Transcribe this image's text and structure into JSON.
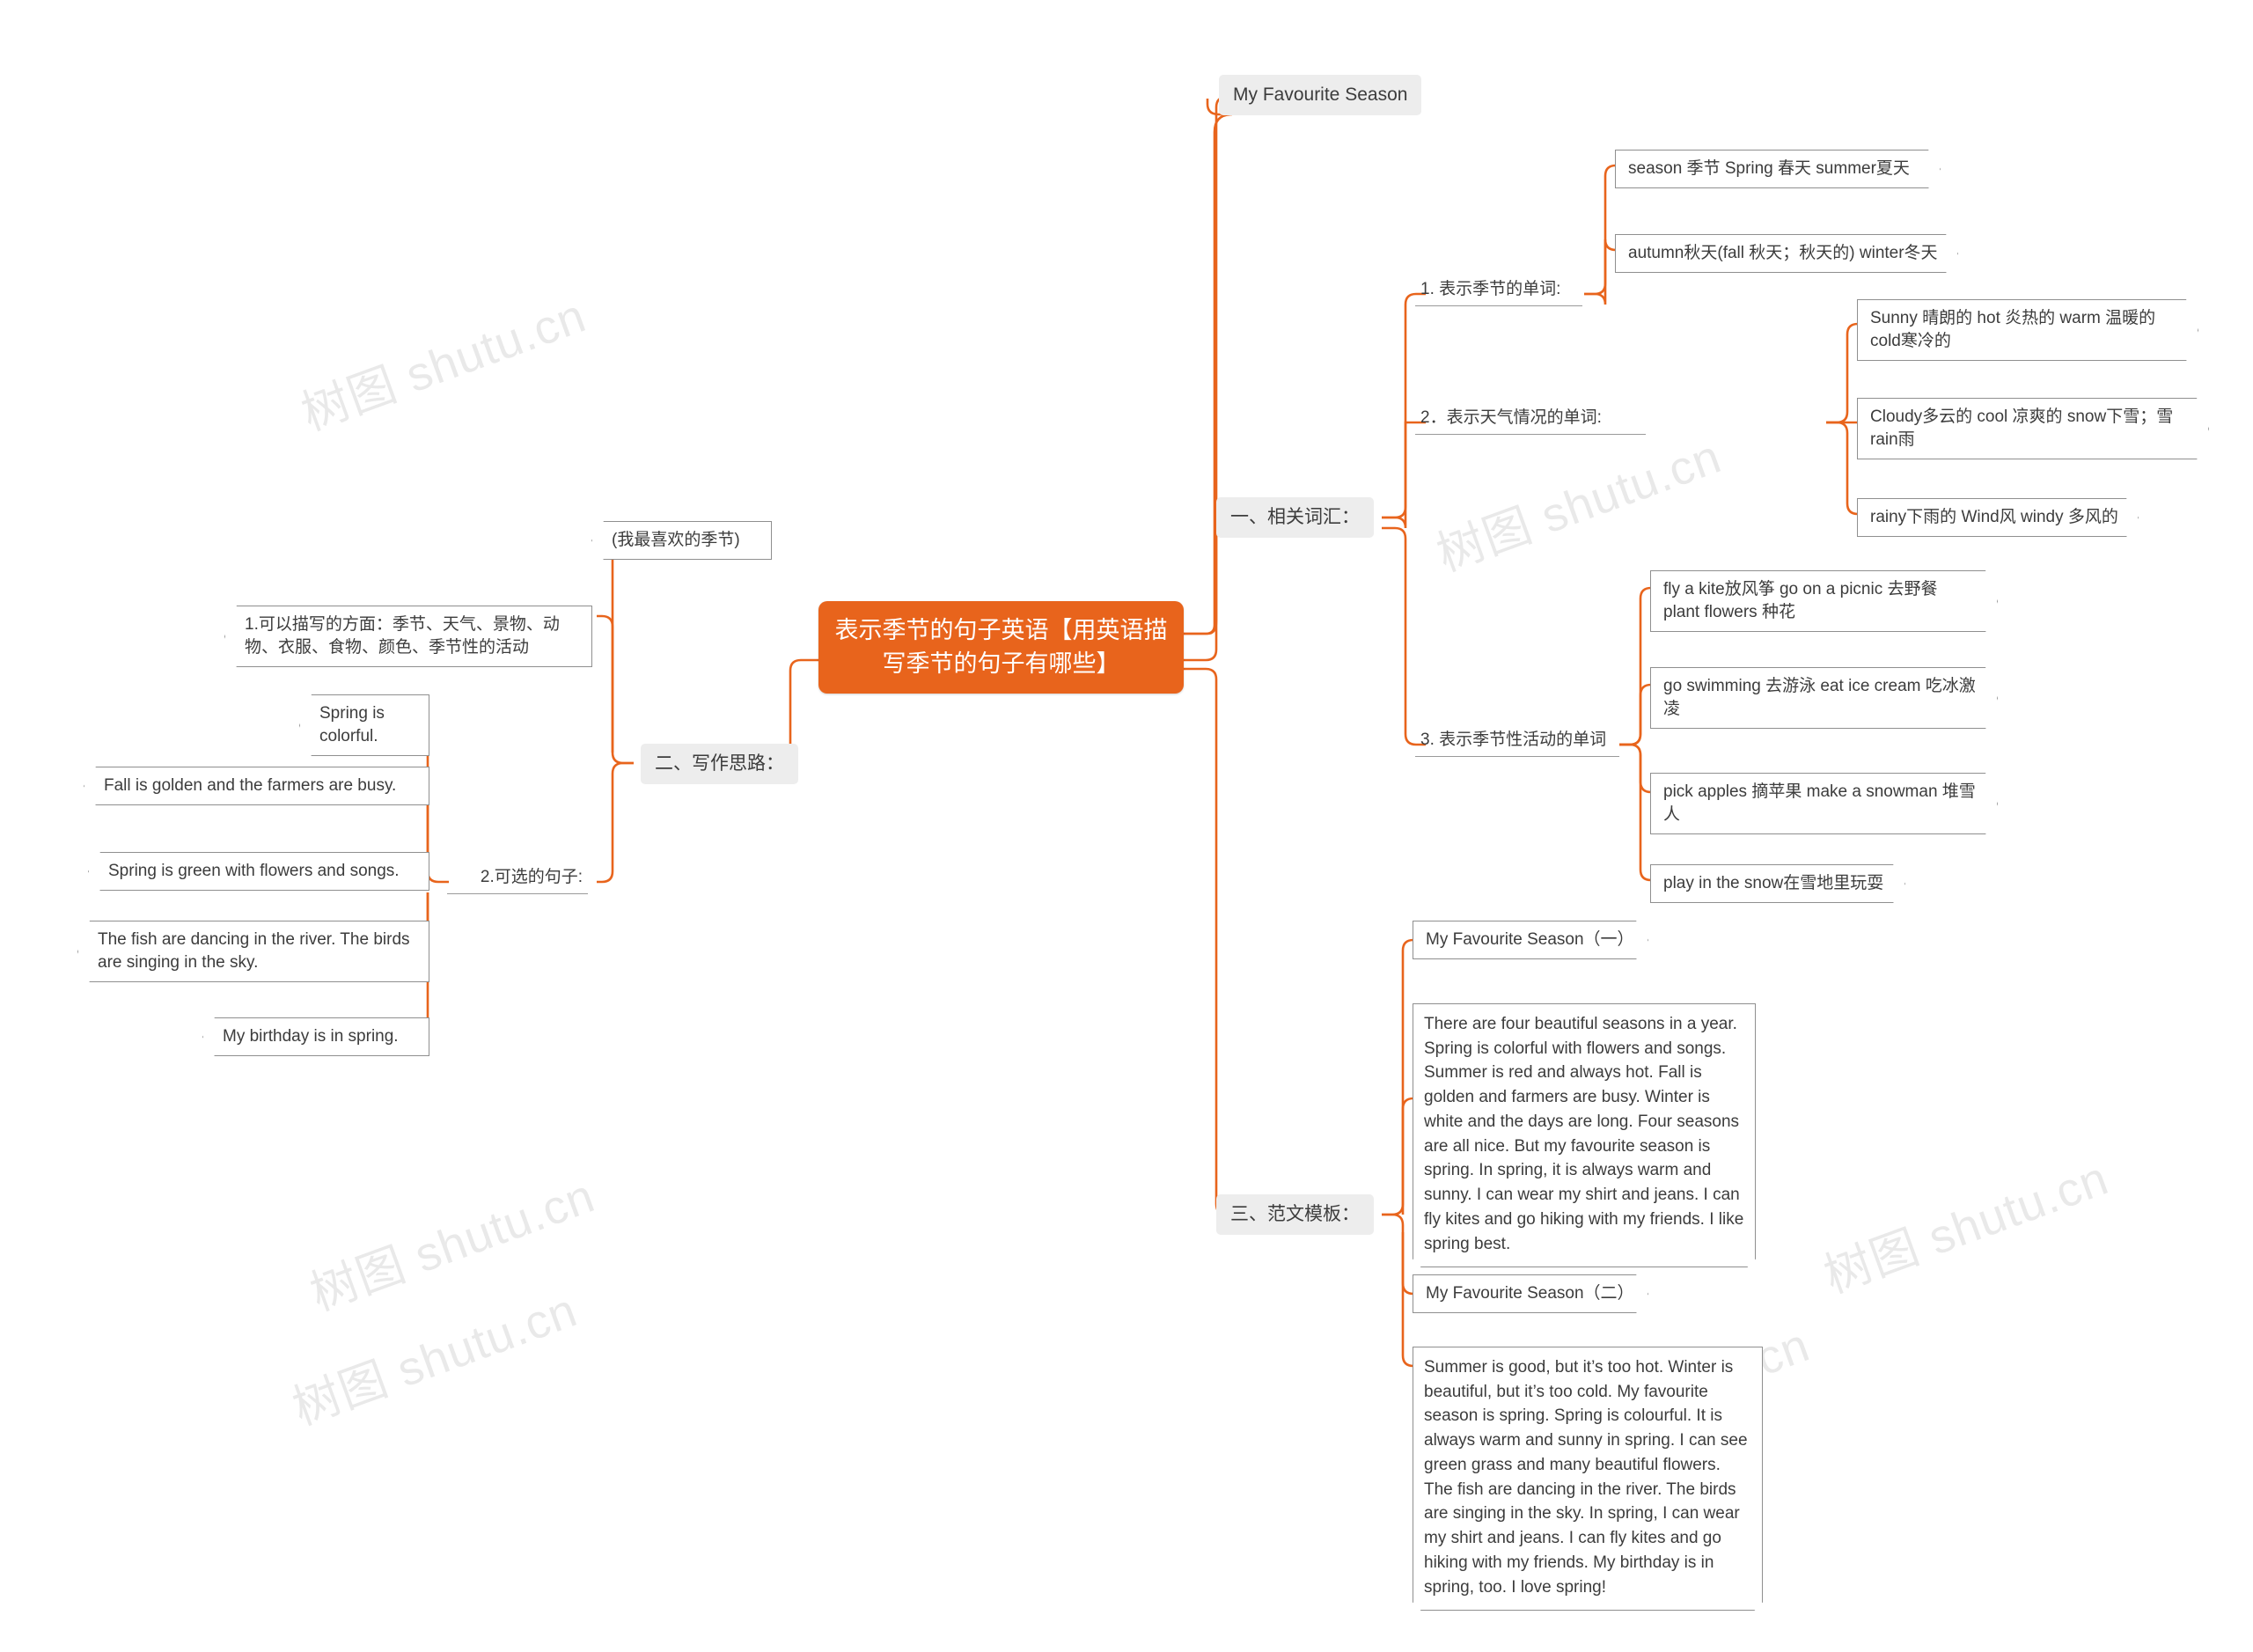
{
  "root": {
    "label": "表示季节的句子英语【用英语描写季节的句子有哪些】"
  },
  "top_node": {
    "label": "My Favourite Season"
  },
  "branches": {
    "vocab": {
      "label": "一、相关词汇："
    },
    "ideas": {
      "label": "二、写作思路："
    },
    "templates": {
      "label": "三、范文模板："
    }
  },
  "vocab_children": [
    {
      "label": "1. 表示季节的单词:"
    },
    {
      "label": "2．表示天气情况的单词:"
    },
    {
      "label": "3. 表示季节性活动的单词"
    }
  ],
  "season_words": [
    {
      "label": "season 季节 Spring 春天 summer夏天"
    },
    {
      "label": "autumn秋天(fall 秋天；秋天的) winter冬天"
    }
  ],
  "weather_words": [
    {
      "label": "Sunny 晴朗的 hot 炎热的 warm 温暖的 cold寒冷的"
    },
    {
      "label": "Cloudy多云的 cool 凉爽的 snow下雪；雪 rain雨"
    },
    {
      "label": "rainy下雨的 Wind风 windy 多风的"
    }
  ],
  "activity_words": [
    {
      "label": "fly a kite放风筝 go on a picnic 去野餐 plant flowers 种花"
    },
    {
      "label": "go swimming 去游泳 eat ice cream 吃冰激凌"
    },
    {
      "label": "pick apples 摘苹果 make a snowman 堆雪人"
    },
    {
      "label": "play in the snow在雪地里玩耍"
    }
  ],
  "ideas_children": [
    {
      "label": "(我最喜欢的季节)"
    },
    {
      "label": "1.可以描写的方面：季节、天气、景物、动物、衣服、食物、颜色、季节性的活动"
    },
    {
      "label": "2.可选的句子:"
    }
  ],
  "sentences": [
    {
      "label": "Spring is colorful."
    },
    {
      "label": "Fall is golden and the farmers are busy."
    },
    {
      "label": "Spring is green with flowers and songs."
    },
    {
      "label": "The fish are dancing in the river. The birds are singing in the sky."
    },
    {
      "label": "My birthday is in spring."
    }
  ],
  "templates": [
    {
      "title": "My Favourite Season（一）",
      "body": "There are four beautiful seasons in a year. Spring is colorful with flowers and songs. Summer is red and always hot. Fall is golden and farmers are busy. Winter is white and the days are long. Four seasons are all nice. But my favourite season is spring. In spring, it is always warm and sunny. I can wear my shirt and jeans. I can fly kites and go hiking with my friends. I like spring best."
    },
    {
      "title": "My Favourite Season（二）",
      "body": "Summer is good, but it’s too hot. Winter is beautiful, but it’s too cold. My favourite season is spring. Spring is colourful. It is always warm and sunny in spring. I can see green grass and many beautiful flowers. The fish are dancing in the river. The birds are singing in the sky. In spring, I can wear my shirt and jeans. I can fly kites and go hiking with my friends. My birthday is in spring, too. I love spring!"
    }
  ],
  "watermarks": [
    {
      "text": "树图 shutu.cn"
    },
    {
      "text": "树图 shutu.cn"
    },
    {
      "text": "树图 shutu.cn"
    },
    {
      "text": "树图 shutu.cn"
    },
    {
      "text": "树图 shutu.cn"
    },
    {
      "text": "hutu.cn"
    }
  ],
  "colors": {
    "accent": "#e8641c",
    "node_border": "#8f8f8f",
    "pill_bg": "#ededed",
    "text": "#3c3c3c"
  }
}
